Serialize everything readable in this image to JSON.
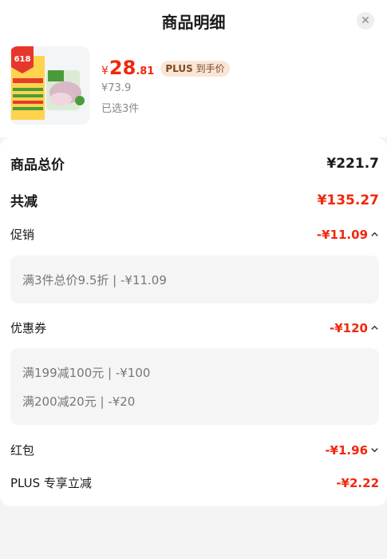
{
  "header": {
    "title": "商品明细",
    "close_icon": "close-icon"
  },
  "product": {
    "price_symbol": "¥",
    "price_int": "28",
    "price_dec": ".81",
    "plus_badge_plus": "PLUS",
    "plus_badge_text": "到手价",
    "original_price": "¥73.9",
    "selected": "已选3件",
    "image_badge": "618"
  },
  "summary": {
    "total_label": "商品总价",
    "total_value": "¥221.7",
    "reduce_label": "共减",
    "reduce_value": "¥135.27",
    "promo_label": "促销",
    "promo_value": "-¥11.09",
    "promo_detail": "满3件总价9.5折 | -¥11.09",
    "coupon_label": "优惠券",
    "coupon_value": "-¥120",
    "coupon_details": [
      "满199减100元 | -¥100",
      "满200减20元 | -¥20"
    ],
    "redpacket_label": "红包",
    "redpacket_value": "-¥1.96",
    "plus_label": "PLUS 专享立减",
    "plus_value": "-¥2.22"
  },
  "colors": {
    "accent_red": "#f2270c",
    "background": "#f4f4f4"
  }
}
